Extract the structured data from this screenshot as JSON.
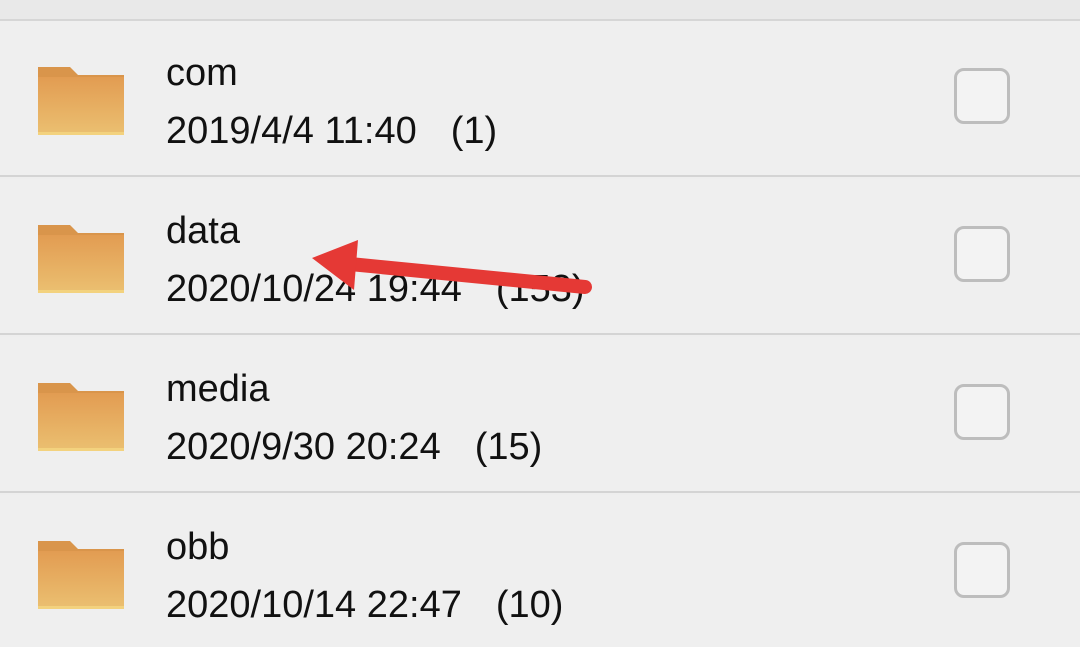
{
  "folders": [
    {
      "name": "com",
      "date": "2019/4/4 11:40",
      "count": "(1)",
      "icon": "folder-icon",
      "checked": false
    },
    {
      "name": "data",
      "date": "2020/10/24 19:44",
      "count": "(153)",
      "icon": "folder-icon",
      "checked": false
    },
    {
      "name": "media",
      "date": "2020/9/30 20:24",
      "count": "(15)",
      "icon": "folder-icon",
      "checked": false
    },
    {
      "name": "obb",
      "date": "2020/10/14 22:47",
      "count": "(10)",
      "icon": "folder-icon",
      "checked": false
    }
  ],
  "colors": {
    "folder_body": "#e7aa5f",
    "folder_tab": "#d99548",
    "arrow": "#e53935",
    "checkbox_border": "#bdbdbd",
    "divider": "#d4d4d4"
  }
}
